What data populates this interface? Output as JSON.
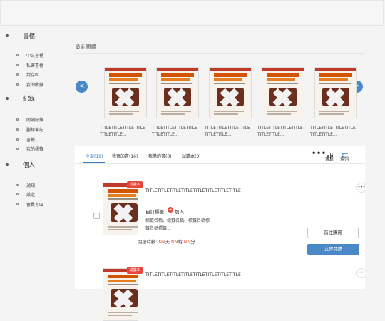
{
  "sidebar": {
    "sections": [
      {
        "title": "書櫃",
        "items": [
          "中文書櫃",
          "私密書櫃",
          "封存區",
          "我的收藏"
        ]
      },
      {
        "title": "紀錄",
        "items": [
          "閱讀紀錄",
          "劃線筆記",
          "書籤",
          "我的標籤"
        ]
      },
      {
        "title": "個人",
        "items": [
          "通知",
          "設定",
          "會員專區"
        ]
      }
    ]
  },
  "recent": {
    "title": "最近閱讀",
    "items": [
      {
        "title": "TITLETITLETITLETITLETITLETITLE…"
      },
      {
        "title": "TITLETITLETITLETITLETITLETITLE…"
      },
      {
        "title": "TITLETITLETITLETITLETITLETITLE…"
      },
      {
        "title": "TITLETITLETITLETITLETITLETITLE…"
      },
      {
        "title": "TITLETITLETITLETITLETITLETITLE…"
      }
    ],
    "prev_label": "<",
    "next_label": ">"
  },
  "tabs": {
    "all": "全部(19)",
    "purchased": "我買的書(16)",
    "subscribed": "我借的書(0)",
    "trial": "試讀本(3)",
    "more": "•••",
    "view_grid": "書封",
    "view_list": "條列"
  },
  "books": [
    {
      "badge": "試讀本",
      "title": "TITLETITLETITLETITLETITLETITLETITLETITLE",
      "tag_label": "自訂標籤:",
      "add_label": "加入",
      "tag_names": "標籤名稱、標籤名稱、標籤名稱標籤名稱標籤…",
      "read_time_prefix": "閱讀時數: ",
      "nn": "NN",
      "day": "天 ",
      "hour": "時 ",
      "minute": "分",
      "buy_label": "前往購買",
      "read_label": "立即閱讀",
      "more": "•••"
    },
    {
      "badge": "試讀本",
      "title": "TITLETITLETITLETITLETITLETITLETITLETITLE",
      "more": "•••"
    }
  ],
  "colors": {
    "accent": "#4a88c7",
    "red": "#e8453c"
  }
}
